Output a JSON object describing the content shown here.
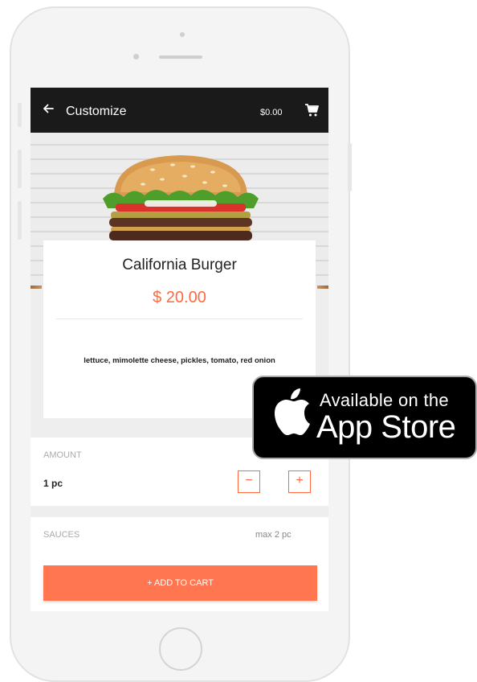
{
  "app_bar": {
    "title": "Customize",
    "cart_total": "$0.00",
    "back_icon": "arrow-left-icon",
    "cart_icon": "shopping-cart-icon"
  },
  "product": {
    "name": "California Burger",
    "price": "$ 20.00",
    "description": "lettuce, mimolette cheese, pickles, tomato, red onion"
  },
  "amount": {
    "label": "AMOUNT",
    "value": "1 pc",
    "decrement_symbol": "−",
    "increment_symbol": "+"
  },
  "sauces": {
    "label": "SAUCES",
    "limit": "max 2 pc"
  },
  "add_to_cart": {
    "label": "+ ADD TO CART"
  },
  "app_store_badge": {
    "line1": "Available on the",
    "line2": "App Store",
    "icon": "apple-logo-icon"
  },
  "colors": {
    "accent": "#ff6a3d",
    "button": "#ff7650",
    "app_bar": "#1a1a1a"
  }
}
